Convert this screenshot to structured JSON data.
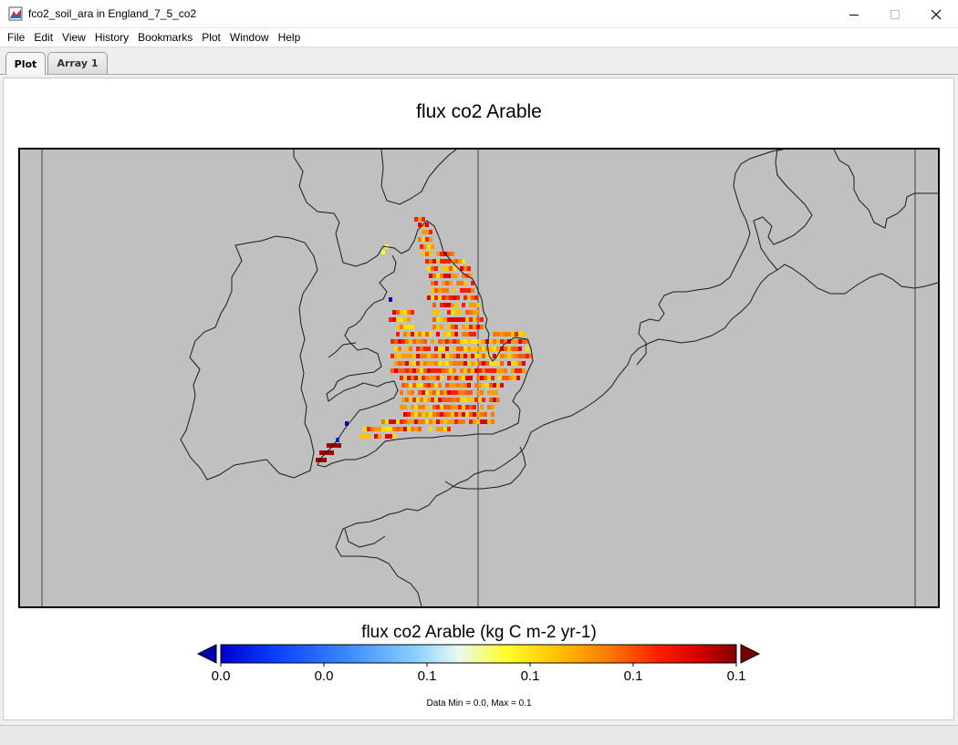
{
  "window": {
    "title": "fco2_soil_ara in England_7_5_co2",
    "app_icon": "panoply-app-icon",
    "controls": [
      "minimize-icon",
      "maximize-icon",
      "close-icon"
    ]
  },
  "menu": {
    "items": [
      "File",
      "Edit",
      "View",
      "History",
      "Bookmarks",
      "Plot",
      "Window",
      "Help"
    ]
  },
  "tabs": [
    {
      "label": "Plot",
      "active": true
    },
    {
      "label": "Array 1",
      "active": false
    }
  ],
  "plot": {
    "title": "flux co2  Arable",
    "map_background": "#c0c0c0",
    "colorbar": {
      "title": "flux co2  Arable (kg C m-2 yr-1)",
      "tick_labels": [
        "0.0",
        "0.0",
        "0.1",
        "0.1",
        "0.1",
        "0.1"
      ],
      "colors": [
        "#0000cc",
        "#0a3cff",
        "#3c8cff",
        "#8cd2ff",
        "#eaf8f0",
        "#ffff30",
        "#ffc400",
        "#ff7a00",
        "#ff1e00",
        "#d20000",
        "#820000"
      ],
      "under_color": "#0000b0",
      "over_color": "#780000"
    },
    "data_range_text": "Data Min = 0.0, Max = 0.1"
  },
  "chart_data": {
    "type": "heatmap",
    "title": "flux co2  Arable",
    "colorbar_label": "flux co2  Arable (kg C m-2 yr-1)",
    "colorbar_ticks": [
      "0.0",
      "0.0",
      "0.1",
      "0.1",
      "0.1",
      "0.1"
    ],
    "data_min": 0.0,
    "data_max": 0.1,
    "region": "England",
    "grid": true
  }
}
